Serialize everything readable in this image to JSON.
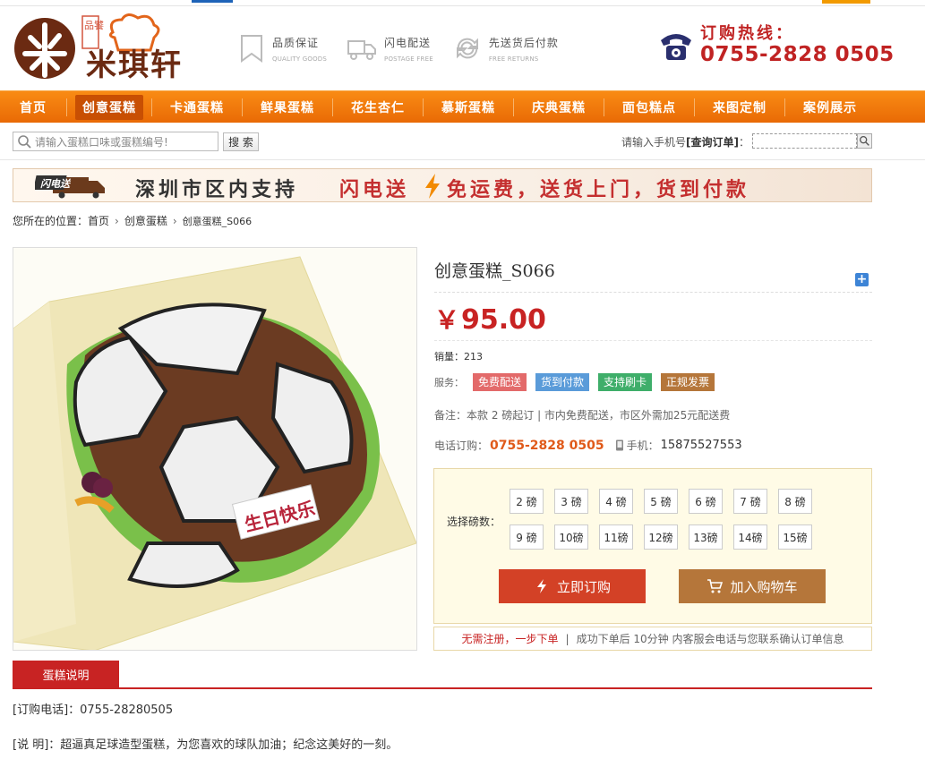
{
  "colors": {
    "brand_orange": "#f07a0c",
    "brand_red": "#c82323",
    "cart_brown": "#b5763a"
  },
  "logo": {
    "name": "米琪轩",
    "seal": "品饕",
    "icon": "chef-hat-icon"
  },
  "features": [
    {
      "cn": "品质保证",
      "en": "QUALITY GOODS",
      "icon": "bookmark-icon"
    },
    {
      "cn": "闪电配送",
      "en": "POSTAGE FREE",
      "icon": "truck-icon"
    },
    {
      "cn": "先送货后付款",
      "en": "FREE RETURNS",
      "icon": "return-arrows-icon"
    }
  ],
  "hotline": {
    "label": "订购热线：",
    "number": "0755-2828 0505"
  },
  "nav": {
    "items": [
      "首页",
      "创意蛋糕",
      "卡通蛋糕",
      "鲜果蛋糕",
      "花生杏仁",
      "慕斯蛋糕",
      "庆典蛋糕",
      "面包糕点",
      "来图定制",
      "案例展示"
    ],
    "active_index": 1
  },
  "search": {
    "placeholder": "请输入蛋糕口味或蛋糕编号!",
    "button": "搜 索",
    "order_query_prefix": "请输入手机号",
    "order_query_label": "[查询订单]",
    "order_query_suffix": "："
  },
  "banner": {
    "badge": "闪电送",
    "text1": "深圳市区内支持",
    "text2": "闪电送",
    "text3": "免运费，送货上门，货到付款"
  },
  "breadcrumb": {
    "prefix": "您所在的位置：",
    "items": [
      "首页",
      "创意蛋糕",
      "创意蛋糕_S066"
    ]
  },
  "product": {
    "title": "创意蛋糕_S066",
    "currency": "￥",
    "price": "95.00",
    "sales_label": "销量：",
    "sales": "213",
    "service_label": "服务：",
    "services": [
      {
        "label": "免费配送",
        "color": "#e36a6a"
      },
      {
        "label": "货到付款",
        "color": "#5a9bd9"
      },
      {
        "label": "支持刷卡",
        "color": "#3fae6a"
      },
      {
        "label": "正规发票",
        "color": "#b5763a"
      }
    ],
    "note": "备注：本款 2 磅起订 | 市内免费配送，市区外需加25元配送费",
    "phone_label": "电话订购：",
    "phone": "0755-2828 0505",
    "mobile_label": "手机：",
    "mobile": "15875527553",
    "image_plaque": "生日快乐"
  },
  "weight": {
    "label": "选择磅数：",
    "row1": [
      "2 磅",
      "3 磅",
      "4 磅",
      "5 磅",
      "6 磅",
      "7 磅",
      "8 磅"
    ],
    "row2": [
      "9 磅",
      "10磅",
      "11磅",
      "12磅",
      "13磅",
      "14磅",
      "15磅"
    ]
  },
  "buttons": {
    "buy": "立即订购",
    "cart": "加入购物车"
  },
  "tip": {
    "red": "无需注册，一步下单",
    "sep": "|",
    "text": "成功下单后 10分钟 内客服会电话与您联系确认订单信息"
  },
  "description": {
    "tab": "蛋糕说明",
    "line1": "[订购电话]：0755-28280505",
    "line2": "[说 明]：超逼真足球造型蛋糕，为您喜欢的球队加油；纪念这美好的一刻。"
  }
}
